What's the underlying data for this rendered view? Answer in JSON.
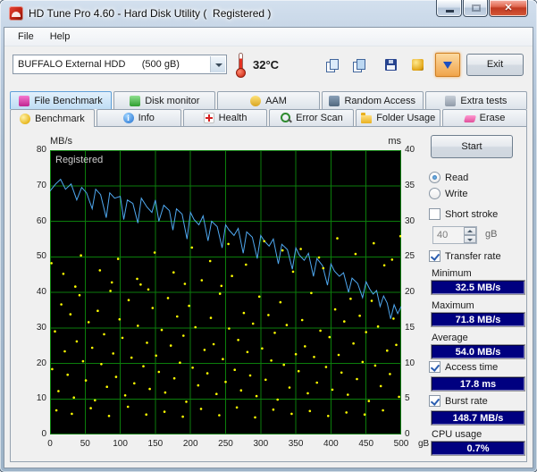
{
  "window": {
    "title": "HD Tune Pro 4.60 - Hard Disk Utility (  Registered )"
  },
  "menu": {
    "items": [
      "File",
      "Help"
    ]
  },
  "toolbar": {
    "drive_select": "BUFFALO External HDD      (500 gB)",
    "temperature": "32°C",
    "exit_label": "Exit"
  },
  "tabs": {
    "row1": [
      {
        "label": "File Benchmark"
      },
      {
        "label": "Disk monitor"
      },
      {
        "label": "AAM"
      },
      {
        "label": "Random Access"
      },
      {
        "label": "Extra tests"
      }
    ],
    "row2": [
      {
        "label": "Benchmark"
      },
      {
        "label": "Info"
      },
      {
        "label": "Health"
      },
      {
        "label": "Error Scan"
      },
      {
        "label": "Folder Usage"
      },
      {
        "label": "Erase"
      }
    ]
  },
  "benchmark": {
    "start_label": "Start",
    "read_label": "Read",
    "write_label": "Write",
    "short_stroke_label": "Short stroke",
    "short_stroke_value": "40",
    "short_stroke_unit": "gB",
    "transfer_rate_label": "Transfer rate",
    "minimum_label": "Minimum",
    "minimum_value": "32.5 MB/s",
    "maximum_label": "Maximum",
    "maximum_value": "71.8 MB/s",
    "average_label": "Average",
    "average_value": "54.0 MB/s",
    "access_time_label": "Access time",
    "access_time_value": "17.8 ms",
    "burst_rate_label": "Burst rate",
    "burst_rate_value": "148.7 MB/s",
    "cpu_usage_label": "CPU usage",
    "cpu_usage_value": "0.7%"
  },
  "chart_data": {
    "type": "line",
    "watermark": "Registered",
    "bg_color": "#000000",
    "grid_color": "#0b7d0b",
    "x_axis": {
      "label": "gB",
      "min": 0,
      "max": 500,
      "ticks": [
        0,
        50,
        100,
        150,
        200,
        250,
        300,
        350,
        400,
        450,
        500
      ]
    },
    "y_left_axis": {
      "label": "MB/s",
      "min": 0,
      "max": 80,
      "ticks": [
        80,
        70,
        60,
        50,
        40,
        30,
        20,
        10,
        0
      ]
    },
    "y_right_axis": {
      "label": "ms",
      "min": 0,
      "max": 40,
      "ticks": [
        40,
        35,
        30,
        25,
        20,
        15,
        10,
        5,
        0
      ]
    },
    "series": [
      {
        "name": "transfer_rate",
        "type": "line",
        "axis": "left",
        "color": "#4fa8f0",
        "points": [
          [
            0,
            68.5
          ],
          [
            8,
            70.5
          ],
          [
            15,
            71.8
          ],
          [
            22,
            69
          ],
          [
            30,
            70.5
          ],
          [
            38,
            66
          ],
          [
            45,
            69.5
          ],
          [
            52,
            68
          ],
          [
            60,
            63.5
          ],
          [
            65,
            69
          ],
          [
            72,
            67.5
          ],
          [
            80,
            61
          ],
          [
            85,
            68
          ],
          [
            92,
            66.5
          ],
          [
            100,
            67
          ],
          [
            105,
            60.5
          ],
          [
            110,
            66
          ],
          [
            118,
            65
          ],
          [
            125,
            59.5
          ],
          [
            130,
            66.5
          ],
          [
            138,
            64
          ],
          [
            145,
            62.5
          ],
          [
            150,
            66
          ],
          [
            155,
            60
          ],
          [
            162,
            64.5
          ],
          [
            170,
            63
          ],
          [
            175,
            57.5
          ],
          [
            180,
            63.5
          ],
          [
            188,
            62
          ],
          [
            195,
            55
          ],
          [
            200,
            62.5
          ],
          [
            205,
            60.5
          ],
          [
            212,
            59
          ],
          [
            218,
            61.5
          ],
          [
            225,
            54.5
          ],
          [
            230,
            60
          ],
          [
            238,
            58.5
          ],
          [
            245,
            52.5
          ],
          [
            250,
            59
          ],
          [
            255,
            57.5
          ],
          [
            262,
            56
          ],
          [
            268,
            58
          ],
          [
            275,
            51
          ],
          [
            280,
            57
          ],
          [
            288,
            55.5
          ],
          [
            295,
            49.5
          ],
          [
            300,
            56
          ],
          [
            305,
            54.5
          ],
          [
            312,
            53
          ],
          [
            318,
            55
          ],
          [
            325,
            48
          ],
          [
            330,
            53.5
          ],
          [
            338,
            52
          ],
          [
            345,
            46.5
          ],
          [
            350,
            52.5
          ],
          [
            355,
            50.5
          ],
          [
            362,
            49
          ],
          [
            368,
            51
          ],
          [
            375,
            44.5
          ],
          [
            380,
            49.5
          ],
          [
            388,
            47.5
          ],
          [
            395,
            42
          ],
          [
            400,
            48
          ],
          [
            405,
            46
          ],
          [
            412,
            44.5
          ],
          [
            418,
            45.5
          ],
          [
            425,
            40
          ],
          [
            430,
            44
          ],
          [
            438,
            42.5
          ],
          [
            445,
            38.5
          ],
          [
            450,
            43
          ],
          [
            455,
            41
          ],
          [
            460,
            39.5
          ],
          [
            465,
            40.5
          ],
          [
            470,
            36
          ],
          [
            475,
            39
          ],
          [
            480,
            37
          ],
          [
            485,
            32.5
          ],
          [
            490,
            36.5
          ],
          [
            495,
            34
          ],
          [
            500,
            36
          ]
        ]
      },
      {
        "name": "access_time",
        "type": "scatter",
        "axis": "right",
        "color": "#ffff00",
        "points": [
          [
            3,
            9.2
          ],
          [
            7,
            14.5
          ],
          [
            12,
            6.1
          ],
          [
            16,
            18.3
          ],
          [
            21,
            11.7
          ],
          [
            25,
            8.4
          ],
          [
            29,
            16.9
          ],
          [
            34,
            5.2
          ],
          [
            38,
            13.1
          ],
          [
            42,
            19.6
          ],
          [
            47,
            10.3
          ],
          [
            51,
            7.6
          ],
          [
            55,
            15.8
          ],
          [
            60,
            12.2
          ],
          [
            64,
            4.8
          ],
          [
            68,
            17.4
          ],
          [
            73,
            9.9
          ],
          [
            77,
            14.1
          ],
          [
            81,
            6.7
          ],
          [
            86,
            20.2
          ],
          [
            90,
            11.4
          ],
          [
            94,
            8.1
          ],
          [
            99,
            16.2
          ],
          [
            103,
            13.6
          ],
          [
            107,
            5.5
          ],
          [
            112,
            18.9
          ],
          [
            116,
            10.8
          ],
          [
            120,
            7.2
          ],
          [
            125,
            15.3
          ],
          [
            129,
            21.1
          ],
          [
            133,
            9.6
          ],
          [
            138,
            12.9
          ],
          [
            142,
            6.4
          ],
          [
            146,
            17.8
          ],
          [
            151,
            11.1
          ],
          [
            155,
            8.8
          ],
          [
            159,
            14.7
          ],
          [
            164,
            5.9
          ],
          [
            168,
            19.2
          ],
          [
            172,
            12.5
          ],
          [
            177,
            7.9
          ],
          [
            181,
            16.6
          ],
          [
            185,
            10.1
          ],
          [
            190,
            13.9
          ],
          [
            194,
            4.6
          ],
          [
            198,
            18.1
          ],
          [
            203,
            9.4
          ],
          [
            207,
            15.1
          ],
          [
            211,
            6.9
          ],
          [
            216,
            21.7
          ],
          [
            220,
            11.9
          ],
          [
            224,
            8.6
          ],
          [
            229,
            16.4
          ],
          [
            233,
            12.7
          ],
          [
            237,
            5.7
          ],
          [
            242,
            19.8
          ],
          [
            246,
            10.6
          ],
          [
            250,
            7.4
          ],
          [
            255,
            14.9
          ],
          [
            259,
            22.3
          ],
          [
            263,
            9.1
          ],
          [
            268,
            13.3
          ],
          [
            272,
            6.2
          ],
          [
            276,
            17.1
          ],
          [
            281,
            11.6
          ],
          [
            285,
            8.3
          ],
          [
            289,
            15.6
          ],
          [
            294,
            5.4
          ],
          [
            298,
            19.4
          ],
          [
            302,
            12.1
          ],
          [
            307,
            7.7
          ],
          [
            311,
            16.8
          ],
          [
            315,
            10.4
          ],
          [
            320,
            14.3
          ],
          [
            324,
            4.9
          ],
          [
            328,
            18.6
          ],
          [
            333,
            9.8
          ],
          [
            337,
            15.4
          ],
          [
            341,
            6.6
          ],
          [
            346,
            22.9
          ],
          [
            350,
            11.3
          ],
          [
            354,
            8.9
          ],
          [
            359,
            16.1
          ],
          [
            363,
            12.4
          ],
          [
            367,
            5.8
          ],
          [
            372,
            19.9
          ],
          [
            376,
            10.9
          ],
          [
            380,
            7.3
          ],
          [
            385,
            14.6
          ],
          [
            389,
            23.4
          ],
          [
            393,
            9.5
          ],
          [
            398,
            13.7
          ],
          [
            402,
            6.3
          ],
          [
            406,
            17.6
          ],
          [
            411,
            11.2
          ],
          [
            415,
            8.7
          ],
          [
            419,
            15.9
          ],
          [
            424,
            5.6
          ],
          [
            428,
            19.1
          ],
          [
            432,
            12.8
          ],
          [
            437,
            7.8
          ],
          [
            441,
            16.7
          ],
          [
            445,
            10.2
          ],
          [
            450,
            14.4
          ],
          [
            454,
            4.7
          ],
          [
            458,
            18.8
          ],
          [
            463,
            9.7
          ],
          [
            467,
            15.2
          ],
          [
            471,
            6.8
          ],
          [
            476,
            23.8
          ],
          [
            480,
            11.8
          ],
          [
            484,
            8.5
          ],
          [
            489,
            16.3
          ],
          [
            493,
            12.6
          ],
          [
            497,
            5.3
          ],
          [
            2,
            24.1
          ],
          [
            9,
            3.4
          ],
          [
            19,
            22.6
          ],
          [
            31,
            2.9
          ],
          [
            44,
            25.2
          ],
          [
            58,
            3.7
          ],
          [
            71,
            23.1
          ],
          [
            84,
            2.6
          ],
          [
            97,
            24.7
          ],
          [
            111,
            3.9
          ],
          [
            124,
            21.9
          ],
          [
            137,
            2.8
          ],
          [
            149,
            25.6
          ],
          [
            163,
            3.2
          ],
          [
            176,
            22.8
          ],
          [
            189,
            2.5
          ],
          [
            202,
            26.3
          ],
          [
            215,
            3.6
          ],
          [
            228,
            24.4
          ],
          [
            241,
            2.7
          ],
          [
            254,
            26.8
          ],
          [
            266,
            3.8
          ],
          [
            279,
            23.9
          ],
          [
            292,
            2.4
          ],
          [
            305,
            27.2
          ],
          [
            318,
            3.5
          ],
          [
            331,
            25.9
          ],
          [
            344,
            2.9
          ],
          [
            357,
            26.1
          ],
          [
            370,
            3.3
          ],
          [
            383,
            24.9
          ],
          [
            396,
            2.6
          ],
          [
            409,
            27.6
          ],
          [
            422,
            3.1
          ],
          [
            435,
            25.4
          ],
          [
            448,
            2.8
          ],
          [
            461,
            26.9
          ],
          [
            474,
            3.4
          ],
          [
            487,
            24.6
          ],
          [
            499,
            27.9
          ],
          [
            36,
            20.8
          ],
          [
            88,
            21.4
          ],
          [
            140,
            20.4
          ],
          [
            192,
            21.2
          ],
          [
            244,
            20.9
          ]
        ]
      }
    ]
  }
}
